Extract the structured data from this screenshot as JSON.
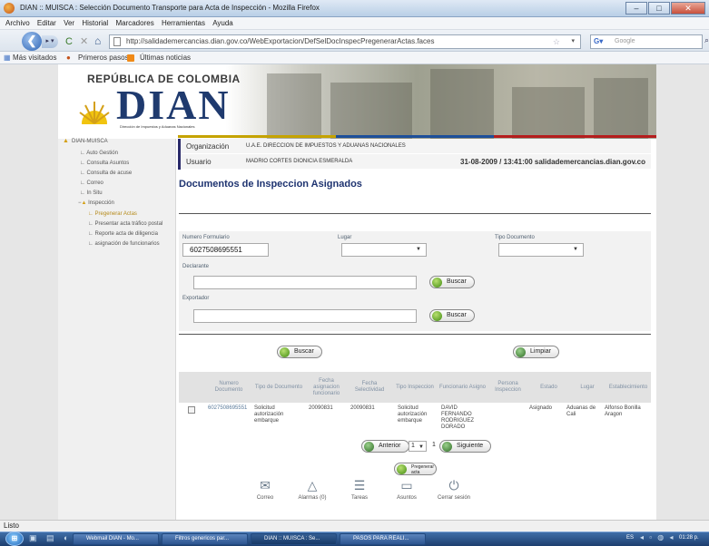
{
  "window": {
    "title": "DIAN :: MUISCA : Selección Documento Transporte para Acta de Inspección - Mozilla Firefox"
  },
  "menubar": [
    "Archivo",
    "Editar",
    "Ver",
    "Historial",
    "Marcadores",
    "Herramientas",
    "Ayuda"
  ],
  "navbar": {
    "url": "http://salidademercancias.dian.gov.co/WebExportacion/DefSelDocInspecPregenerarActas.faces",
    "search_placeholder": "Google"
  },
  "bookmarks": [
    "Más visitados",
    "Primeros pasos",
    "Últimas noticias"
  ],
  "logo": {
    "country": "REPÚBLICA DE COLOMBIA",
    "name": "DIAN",
    "subtitle": "Dirección de Impuestos y Aduanas Nacionales"
  },
  "sidebar": {
    "root": "DIAN-MUISCA",
    "items": [
      "Auto Gestión",
      "Consulta Asuntos",
      "Consulta de acuse",
      "Correo",
      "In Situ"
    ],
    "group": "Inspección",
    "subitems": [
      "Pregenerar Actas",
      "Presentar acta tráfico postal",
      "Reporte acta de diligencia",
      "asignación de funcionarios"
    ]
  },
  "info": {
    "org_label": "Organización",
    "org_value": "U.A.E. DIRECCION DE IMPUESTOS Y ADUANAS NACIONALES",
    "user_label": "Usuario",
    "user_value": "MADRIO CORTES DIONICIA ESMERALDA",
    "datetime_host": "31-08-2009 / 13:41:00 salidademercancias.dian.gov.co"
  },
  "page_title": "Documentos de Inspeccion Asignados",
  "form": {
    "numero_formulario_label": "Numero Formulario",
    "numero_formulario_value": "6027508695551",
    "lugar_label": "Lugar",
    "tipo_documento_label": "Tipo Documento",
    "declarante_label": "Declarante",
    "exportador_label": "Exportador",
    "buscar_label": "Buscar",
    "limpiar_label": "Limpiar"
  },
  "table": {
    "headers": [
      "Numero Documento",
      "Tipo de Documento",
      "Fecha asignacion funcionario",
      "Fecha Selectividad",
      "Tipo Inspeccion",
      "Funcionario Asigno",
      "Persona Inspeccion",
      "Estado",
      "Lugar",
      "Establecimiento"
    ],
    "rows": [
      {
        "numero": "6027508695551",
        "tipo_doc": "Solicitud autorización embarque",
        "fecha_asig": "20090831",
        "fecha_sel": "20090831",
        "tipo_insp": "Solicitud autorización embarque",
        "funcionario": "DAVID FERNANDO RODRIGUEZ DORADO",
        "persona": "",
        "estado": "Asignado",
        "lugar": "Aduanas de Cali",
        "establecimiento": "Alfonso Bonilla Aragon"
      }
    ]
  },
  "pagination": {
    "prev": "Anterior",
    "page": "1",
    "total": "1",
    "next": "Siguiente"
  },
  "pregenerar_label": "Pregenerar acta",
  "footer": [
    "Correo",
    "Alarmas (0)",
    "Tareas",
    "Asuntos",
    "Cerrar sesión"
  ],
  "status": "Listo",
  "taskbar": {
    "tasks": [
      "Webmail DIAN - Mo...",
      "Filtros genericos par...",
      "DIAN :: MUISCA : Se...",
      "PASOS PARA REALI..."
    ],
    "lang": "ES",
    "clock": "01:28 p."
  }
}
